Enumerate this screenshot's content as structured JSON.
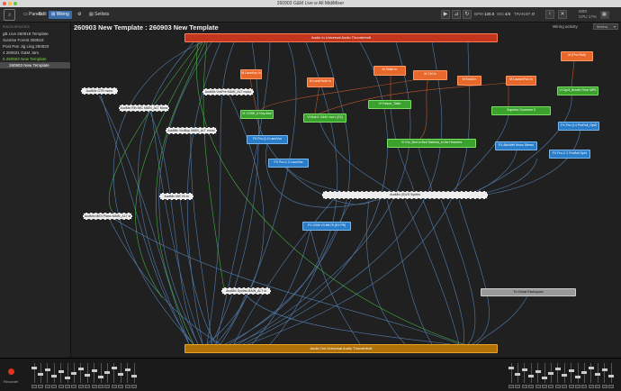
{
  "window": {
    "title": "260903 G&M Live w All MidiMixer"
  },
  "toolbar": {
    "panels_label": "Panels",
    "edit_label": "Edit",
    "wiring_label": "Wiring",
    "setlists_label": "Setlists",
    "bpm_label": "BPM",
    "bpm_value": "120.0",
    "sig_label": "SIG",
    "sig_value": "4/4",
    "transp_label": "TRANSP.",
    "transp_value": "0",
    "midi_label": "MIDI",
    "cpu_label": "CPU",
    "cpu_value": "17%"
  },
  "sidebar": {
    "header": "RACKSPACES",
    "items": [
      {
        "label": "gB Live 260818 Template"
      },
      {
        "label": "Sunrise Forest 260818"
      },
      {
        "label": "Post Pan Jig Ling 260820"
      },
      {
        "label": "4  260831 G&M Jam"
      },
      {
        "label": "5  260903 New Template"
      },
      {
        "label": "260903 New Template"
      }
    ]
  },
  "main": {
    "title": "260903 New Template : 260903 New Template",
    "wiring_activity_label": "Wiring activity",
    "meters_label": "Meters"
  },
  "nodes": {
    "audio_in": "Audio In Universal Audio Thunderbolt",
    "audio_out": "Audio Out Universal Audio Thunderbolt",
    "to_global": "To Global Rackspace",
    "audmix_gtr": "AudMix GTR mono",
    "audmix_rm": "AudMix RM MIC MAIN_ALT Mono",
    "audmix_vox": "AudMix VoxPre MAIN_ALT mono",
    "audmix_voxbu": "AudMix VoxBup MAIN_ALT mono",
    "audmix_mic": "AudMix MIC IN st",
    "audmix_piano": "AudMix MIDI Piano MAIN_ALT st",
    "audmix_synths": "AudMix (S)VS Synths",
    "audmix_synths_alt": "AudMix Synths MAIN_ALT st",
    "mlaunchpad": "M LaunKey In",
    "mlunk": "M LunkPadIn In",
    "mstrike": "M Strike In",
    "mctrl": "M Ctrl In",
    "mknoll": "M Knoll In",
    "mlaunch2": "M LaunchPad In",
    "mpiano": "M (Pno Roll)",
    "vi_core": "VI CORE_6 Nvy Awe",
    "vi_bnk": "VI Bnk K G&M Live1 (S2)",
    "vi_falcon": "VI Falcon_Taiko",
    "vi_om": "VI Om_Bed in Bed Sabrina_In the Heavens",
    "vi_superior": "Superior Drummer 3",
    "vi_opt": "VI Opt3_Breath Flute MPE",
    "fx_proq": "FX Pro-Q 4 LaunVox",
    "fx_proc": "FX Pro-C 2 LaunVox",
    "fx_proq2": "FX Pro-Q 4 ProRoll_Opt3",
    "fx_altwell": "FX AltoWell Mono Stereo",
    "fx_proc2": "FX Pro-C 2 ProRoll Opt3",
    "fx_gsm": "FX GSM V3 MK78 (EX P8)"
  },
  "bottom": {
    "recorder_label": "Recorder"
  }
}
